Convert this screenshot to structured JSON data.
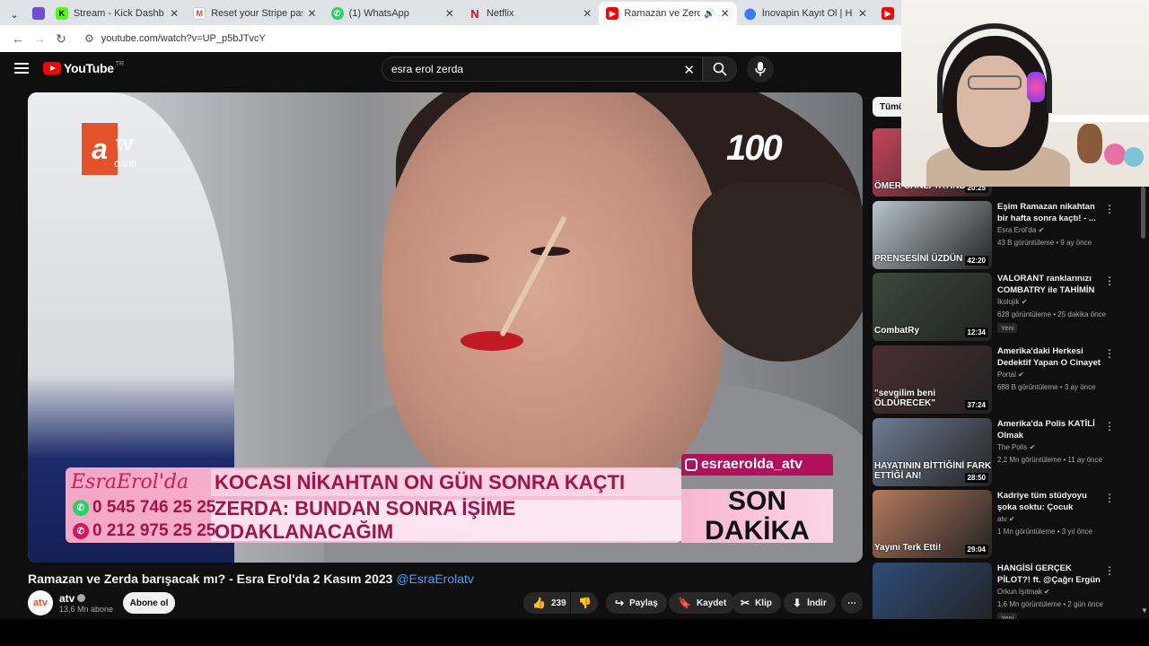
{
  "browser": {
    "tabs": [
      {
        "title": "",
        "favicon": "purple-square",
        "color": "#6b4fd8"
      },
      {
        "title": "Stream - Kick Dashboard",
        "favicon": "K",
        "color": "#53fc18"
      },
      {
        "title": "Reset your Stripe password - ç",
        "favicon": "M",
        "color": "#ea4335"
      },
      {
        "title": "(1) WhatsApp",
        "favicon": "W",
        "color": "#25d366"
      },
      {
        "title": "Netflix",
        "favicon": "N",
        "color": "#e50914"
      },
      {
        "title": "Ramazan ve Zerda barışacə",
        "favicon": "yt",
        "color": "#ff0000"
      },
      {
        "title": "İnovapin Kayıt Ol | Hemen Üy",
        "favicon": "pin",
        "color": "#3d7bf2"
      },
      {
        "title": "",
        "favicon": "yt",
        "color": "#ff0000"
      }
    ],
    "url": "youtube.com/watch?v=UP_p5bJTvcY"
  },
  "youtube": {
    "logo": "YouTube",
    "country": "TR",
    "search": {
      "value": "esra erol zerda"
    },
    "video": {
      "overlay_brand": "EsraErol'da",
      "headline": "KOCASI NİKAHTAN ON GÜN SONRA KAÇTI",
      "subline": "ZERDA: BUNDAN SONRA İŞİME ODAKLANACAĞIM",
      "phone1": "0 545 746 25 25",
      "phone2": "0 212 975 25 25",
      "instagram": "esraerolda_atv",
      "son": "SON",
      "dakika": "DAKİKA",
      "atv_a": "a",
      "atv_tv": "tv",
      "atv_canli": "canlı",
      "badge_100": "100"
    },
    "title": "Ramazan ve Zerda barışacak mı? - Esra Erol'da 2 Kasım 2023",
    "title_tag": "@EsraErolatv",
    "channel": {
      "name": "atv",
      "subs": "13,6 Mn abone",
      "subscribe": "Abone ol",
      "avatar": "atv"
    },
    "actions": {
      "likes": "239",
      "share": "Paylaş",
      "save": "Kaydet",
      "clip": "Klip",
      "download": "İndir"
    },
    "chip": "Tümü",
    "recommendations": [
      {
        "title": "",
        "channel": "",
        "meta": "",
        "duration": "20:25",
        "overlay": "ÖMER CANLI YAYINDA",
        "thumb_color": "#c7435b"
      },
      {
        "title": "Eşim Ramazan nikahtan bir hafta sonra kaçtı! - ...",
        "channel": "Esra Erol'da",
        "meta": "43 B görüntüleme • 9 ay önce",
        "duration": "42:20",
        "overlay": "PRENSESİNİ ÜZDÜN",
        "thumb_color": "#b8c4cc"
      },
      {
        "title": "VALORANT ranklarınızı COMBATRY ile TAHİMİN ...",
        "channel": "İkolojik",
        "meta": "628 görüntüleme • 25 dakika önce",
        "duration": "12:34",
        "overlay": "CombatRy",
        "badge": "Yeni",
        "thumb_color": "#3a4a3a"
      },
      {
        "title": "Amerika'daki Herkesi Dedektif Yapan O Cinayet",
        "channel": "Portal",
        "meta": "688 B görüntüleme • 3 ay önce",
        "duration": "37:24",
        "overlay": "\"sevgilim beni ÖLDÜRECEK\"",
        "thumb_color": "#4a2e34"
      },
      {
        "title": "Amerika'da Polis KATİLİ Olmak",
        "channel": "The Polis",
        "meta": "2,2 Mn görüntüleme • 11 ay önce",
        "duration": "28:50",
        "overlay": "HAYATININ BİTTİĞİNİ FARK ETTİĞİ AN!",
        "thumb_color": "#6f7c93"
      },
      {
        "title": "Kadriye tüm stüdyoyu şoka soktu: Çocuk kimde...",
        "channel": "atv",
        "meta": "1 Mn görüntüleme • 3 yıl önce",
        "duration": "29:04",
        "overlay": "Yayını Terk Etti!",
        "thumb_color": "#b37a5d"
      },
      {
        "title": "HANGİSİ GERÇEK PİLOT?! ft. @Çağrı Ergün",
        "channel": "Orkun Işıtmak",
        "meta": "1,6 Mn görüntüleme • 2 gün önce",
        "duration": "",
        "overlay": "",
        "badge": "Yeni",
        "thumb_color": "#2f4d7a"
      }
    ]
  }
}
